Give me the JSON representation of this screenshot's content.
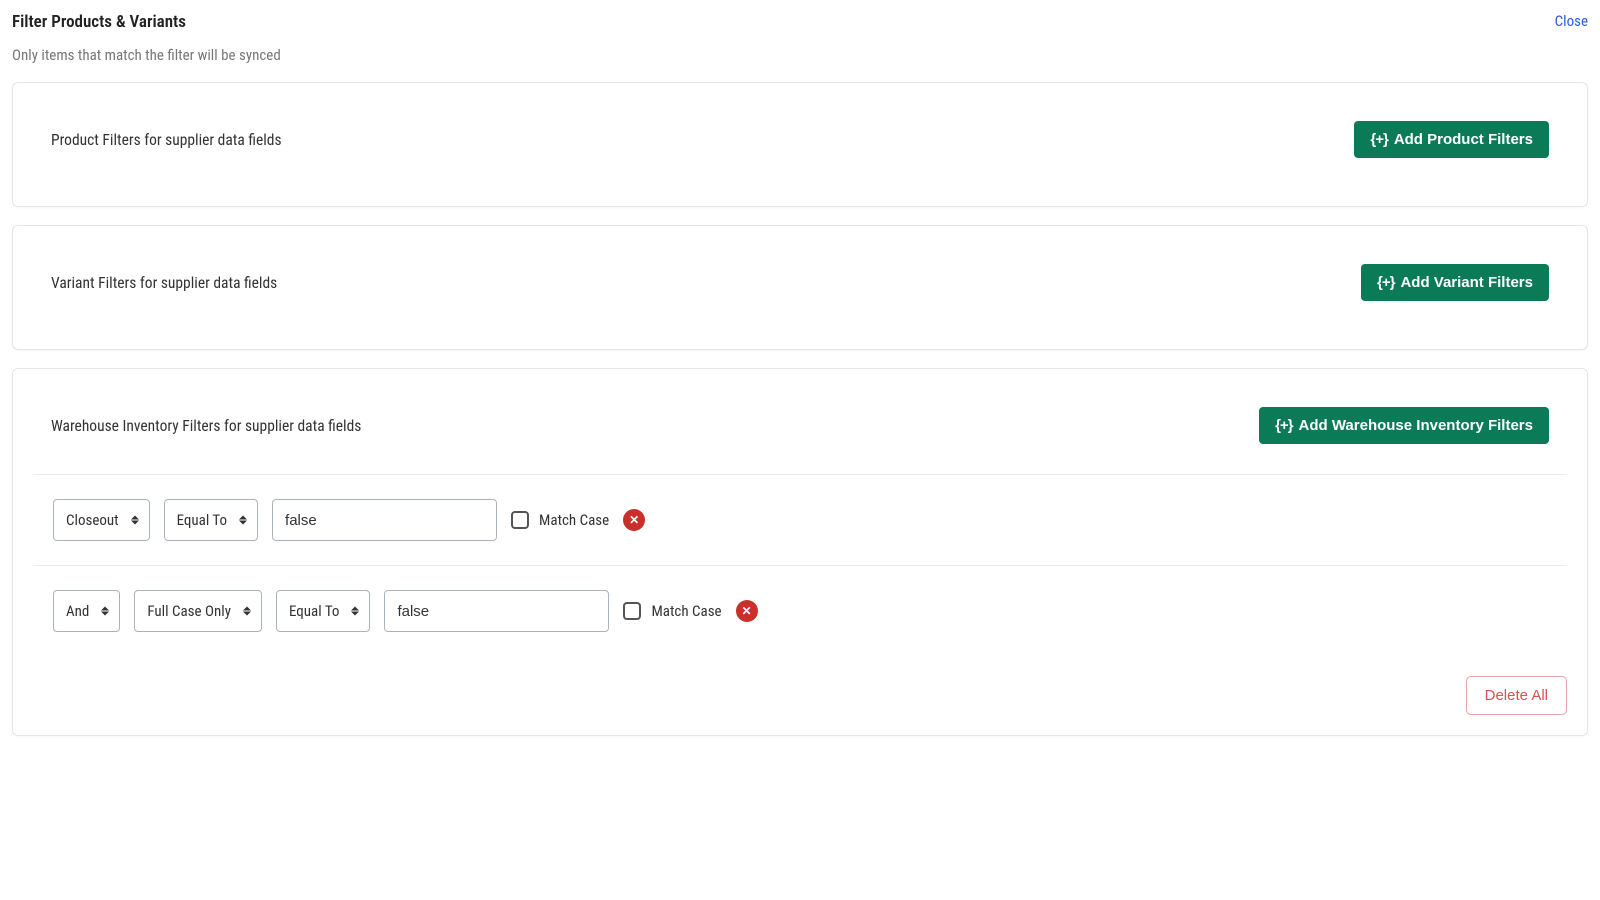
{
  "header": {
    "title": "Filter Products & Variants",
    "subtitle": "Only items that match the filter will be synced",
    "close": "Close"
  },
  "sections": {
    "product": {
      "title": "Product Filters for supplier data fields",
      "add_label": "Add Product Filters"
    },
    "variant": {
      "title": "Variant Filters for supplier data fields",
      "add_label": "Add Variant Filters"
    },
    "warehouse": {
      "title": "Warehouse Inventory Filters for supplier data fields",
      "add_label": "Add Warehouse Inventory Filters",
      "rows": [
        {
          "logic": null,
          "field": "Closeout",
          "operator": "Equal To",
          "value": "false",
          "match_case_label": "Match Case",
          "match_case_checked": false
        },
        {
          "logic": "And",
          "field": "Full Case Only",
          "operator": "Equal To",
          "value": "false",
          "match_case_label": "Match Case",
          "match_case_checked": false
        }
      ],
      "delete_all": "Delete All"
    }
  },
  "icons": {
    "plus_brace": "{+}"
  }
}
